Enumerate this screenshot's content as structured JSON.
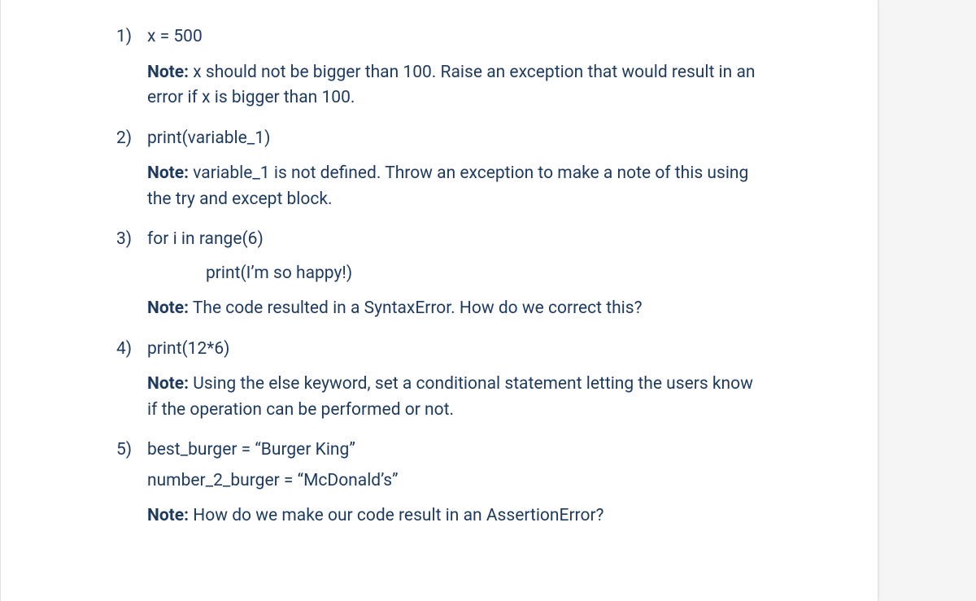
{
  "items": [
    {
      "number": "1)",
      "code_lines": [
        "x = 500"
      ],
      "note_label": "Note:",
      "note_text": " x should not be bigger than 100. Raise an exception that would result in an error if x is bigger than 100."
    },
    {
      "number": "2)",
      "code_lines": [
        "print(variable_1)"
      ],
      "note_label": "Note:",
      "note_text": " variable_1 is not defined. Throw an exception to make a note of this using the try and except block."
    },
    {
      "number": "3)",
      "code_lines": [
        "for i in range(6)"
      ],
      "indented_line": "print(I’m so happy!)",
      "note_label": "Note:",
      "note_text": " The code resulted in a SyntaxError. How do we correct this?"
    },
    {
      "number": "4)",
      "code_lines": [
        "print(12*6)"
      ],
      "note_label": "Note:",
      "note_text": " Using the else keyword, set a conditional statement letting the users know if the operation can be performed or not."
    },
    {
      "number": "5)",
      "code_lines": [
        "best_burger = “Burger King”"
      ],
      "sub_lines": [
        "number_2_burger = “McDonald’s”"
      ],
      "note_label": "Note:",
      "note_text": " How do we make our code result in an AssertionError?"
    }
  ]
}
